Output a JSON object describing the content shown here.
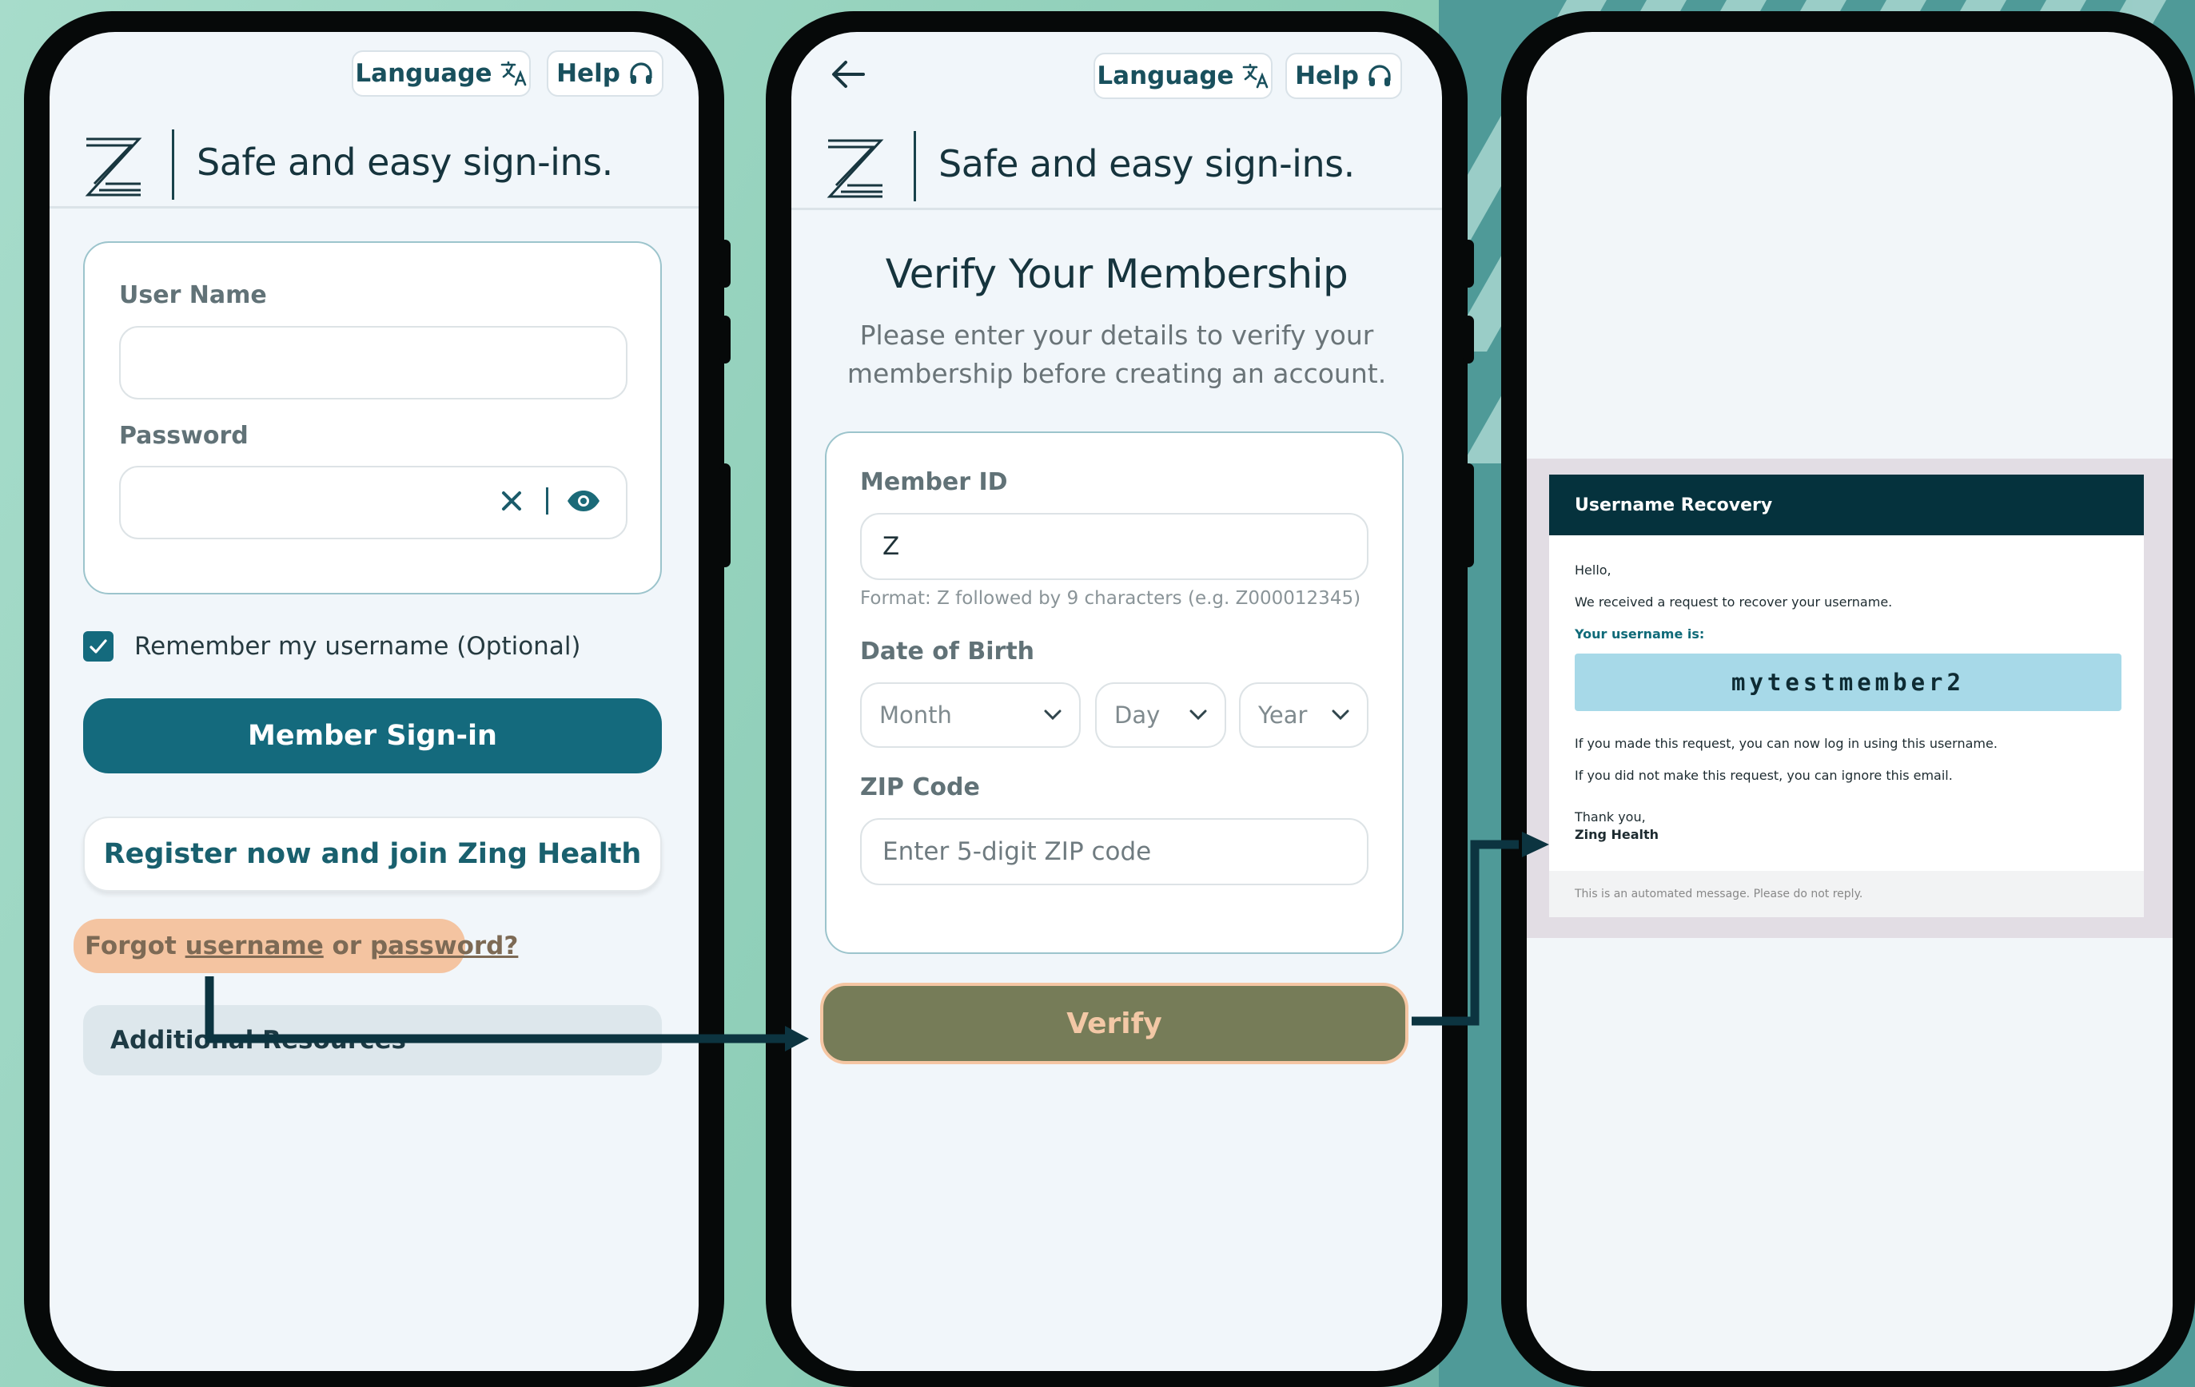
{
  "screen1": {
    "language_label": "Language",
    "help_label": "Help",
    "tagline": "Safe and easy sign-ins.",
    "username_label": "User Name",
    "password_label": "Password",
    "remember_label": "Remember my username (Optional)",
    "remember_checked": true,
    "signin_label": "Member Sign-in",
    "register_label": "Register now and join Zing Health",
    "forgot_prefix": "Forgot ",
    "forgot_username": "username",
    "forgot_or": " or ",
    "forgot_password": "password?",
    "additional_label": "Additional Resources"
  },
  "screen2": {
    "language_label": "Language",
    "help_label": "Help",
    "tagline": "Safe and easy sign-ins.",
    "title": "Verify Your Membership",
    "subtitle_line1": "Please enter your details to verify your",
    "subtitle_line2": "membership before creating an account.",
    "member_id_label": "Member ID",
    "member_id_value": "Z",
    "member_id_hint": "Format: Z followed by 9 characters (e.g. Z000012345)",
    "dob_label": "Date of Birth",
    "month_placeholder": "Month",
    "day_placeholder": "Day",
    "year_placeholder": "Year",
    "zip_label": "ZIP Code",
    "zip_placeholder": "Enter 5-digit ZIP code",
    "verify_label": "Verify"
  },
  "email": {
    "header": "Username Recovery",
    "greeting": "Hello,",
    "line1": "We received a request to recover your username.",
    "username_label": "Your username is:",
    "username": "mytestmember2",
    "line2": "If you made this request, you can now log in using this username.",
    "line3": "If you did not make this request, you can ignore this email.",
    "thanks": "Thank you,",
    "signature": "Zing Health",
    "footer": "This is an automated message. Please do not reply."
  },
  "colors": {
    "brand": "#146a7d",
    "verify": "#767c58",
    "forgot_highlight": "#f4c4a1",
    "email_header": "#05323d",
    "username_bg": "#a7d9e8",
    "background": "#8fcfb9"
  },
  "icons": [
    "translate-icon",
    "headphones-icon",
    "clear-icon",
    "eye-icon",
    "checkbox-check-icon",
    "back-arrow-icon",
    "chevron-down-icon",
    "zing-logo-icon"
  ]
}
